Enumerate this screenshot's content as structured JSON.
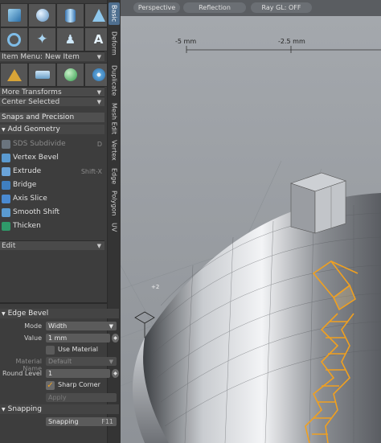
{
  "vtabs": [
    "Basic",
    "Deform",
    "Duplicate",
    "Mesh Edit",
    "Vertex",
    "Edge",
    "Polygon",
    "UV"
  ],
  "item_menu": "Item Menu: New Item",
  "more_transforms": "More Transforms",
  "center_selected": "Center Selected",
  "snaps_section": "Snaps and Precision",
  "add_geometry": "Add Geometry",
  "tools": [
    {
      "label": "SDS Subdivide",
      "hint": "D",
      "color": "#7d8a96"
    },
    {
      "label": "Vertex Bevel",
      "hint": "",
      "color": "#5a9ad0"
    },
    {
      "label": "Extrude",
      "hint": "Shift-X",
      "color": "#6aa3d8"
    },
    {
      "label": "Bridge",
      "hint": "",
      "color": "#3f7fc0"
    },
    {
      "label": "Axis Slice",
      "hint": "",
      "color": "#4a8ad0"
    },
    {
      "label": "Smooth Shift",
      "hint": "",
      "color": "#5a9ad0"
    },
    {
      "label": "Thicken",
      "hint": "",
      "color": "#2f9a6a"
    }
  ],
  "edit_dropdown": "Edit",
  "viewport": {
    "perspective": "Perspective",
    "reflection": "Reflection",
    "raygl": "Ray GL: OFF",
    "ruler_left": "-5 mm",
    "ruler_right": "-2.5 mm",
    "grid_label": "+2"
  },
  "edge_bevel": {
    "title": "Edge Bevel",
    "mode_label": "Mode",
    "mode_value": "Width",
    "value_label": "Value",
    "value_value": "1 mm",
    "use_material": "Use Material",
    "material_label": "Material Name",
    "material_value": "Default",
    "round_label": "Round Level",
    "round_value": "1",
    "sharp_corner": "Sharp Corner",
    "apply": "Apply"
  },
  "snapping": {
    "title": "Snapping",
    "button": "Snapping",
    "key": "F11"
  },
  "colors": {
    "accent": "#f0a020",
    "tab_active": "#4f6f8f"
  }
}
